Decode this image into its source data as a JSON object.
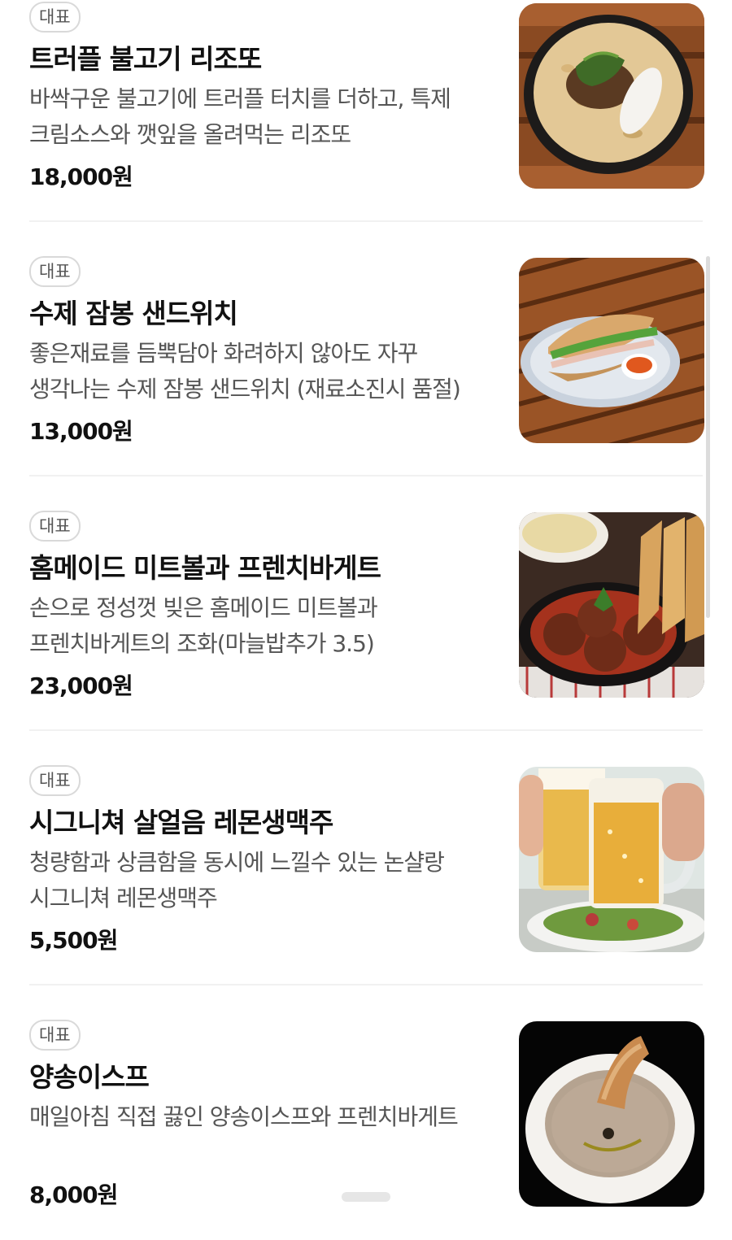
{
  "menu": {
    "items": [
      {
        "badge": "대표",
        "name": "트러플 불고기 리조또",
        "description": "바싹구운 불고기에 트러플 터치를 더하고, 특제 크림소스와 깻잎을 올려먹는 리조또",
        "price": "18,000원",
        "photo_icon": "risotto-photo"
      },
      {
        "badge": "대표",
        "name": "수제 잠봉 샌드위치",
        "description": "좋은재료를 듬뿍담아 화려하지 않아도 자꾸 생각나는 수제 잠봉 샌드위치 (재료소진시 품절)",
        "price": "13,000원",
        "photo_icon": "sandwich-photo"
      },
      {
        "badge": "대표",
        "name": "홈메이드 미트볼과 프렌치바게트",
        "description": "손으로 정성껏 빚은 홈메이드 미트볼과 프렌치바게트의 조화(마늘밥추가 3.5)",
        "price": "23,000원",
        "photo_icon": "meatball-photo"
      },
      {
        "badge": "대표",
        "name": "시그니쳐 살얼음 레몬생맥주",
        "description": "청량함과 상큼함을 동시에 느낄수 있는 논샬랑 시그니쳐 레몬생맥주",
        "price": "5,500원",
        "photo_icon": "beer-photo"
      },
      {
        "badge": "대표",
        "name": "양송이스프",
        "description": "매일아침 직접 끓인 양송이스프와 프렌치바게트",
        "price": "8,000원",
        "photo_icon": "soup-photo"
      }
    ]
  },
  "colors": {
    "text_primary": "#111111",
    "text_secondary": "#555555",
    "badge_border": "#d9d9d9",
    "divider": "#f1f1f1"
  }
}
